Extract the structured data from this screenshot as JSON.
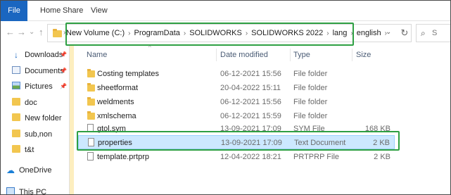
{
  "ribbon": {
    "tabs": [
      "File",
      "Home",
      "Share",
      "View"
    ]
  },
  "nav": {
    "back": "←",
    "forward": "→",
    "dropdown": "⌄",
    "up": "↑"
  },
  "address": {
    "crumbs": [
      "New Volume (C:)",
      "ProgramData",
      "SOLIDWORKS",
      "SOLIDWORKS 2022",
      "lang",
      "english"
    ],
    "separator": "›",
    "dropdown": "⌄",
    "refresh": "↻"
  },
  "search": {
    "placeholder": "S"
  },
  "sidebar": {
    "items": [
      {
        "label": "Downloads",
        "icon": "download-icon",
        "pinned": true
      },
      {
        "label": "Documents",
        "icon": "documents-icon",
        "pinned": true
      },
      {
        "label": "Pictures",
        "icon": "pictures-icon",
        "pinned": true
      },
      {
        "label": "doc",
        "icon": "folder-icon"
      },
      {
        "label": "New folder",
        "icon": "folder-icon"
      },
      {
        "label": "sub,non",
        "icon": "folder-icon"
      },
      {
        "label": "t&t",
        "icon": "folder-icon"
      },
      {
        "label": "OneDrive",
        "icon": "onedrive-icon"
      },
      {
        "label": "This PC",
        "icon": "pc-icon"
      }
    ],
    "pin_glyph": "📌"
  },
  "columns": {
    "name": "Name",
    "date": "Date modified",
    "type": "Type",
    "size": "Size",
    "sort_glyph": "^"
  },
  "files": [
    {
      "name": "Costing templates",
      "date": "06-12-2021 15:56",
      "type": "File folder",
      "size": "",
      "kind": "folder"
    },
    {
      "name": "sheetformat",
      "date": "20-04-2022 15:11",
      "type": "File folder",
      "size": "",
      "kind": "folder"
    },
    {
      "name": "weldments",
      "date": "06-12-2021 15:56",
      "type": "File folder",
      "size": "",
      "kind": "folder"
    },
    {
      "name": "xmlschema",
      "date": "06-12-2021 15:59",
      "type": "File folder",
      "size": "",
      "kind": "folder"
    },
    {
      "name": "gtol.sym",
      "date": "13-09-2021 17:09",
      "type": "SYM File",
      "size": "168 KB",
      "kind": "file"
    },
    {
      "name": "properties",
      "date": "13-09-2021 17:09",
      "type": "Text Document",
      "size": "2 KB",
      "kind": "file",
      "selected": true
    },
    {
      "name": "template.prtprp",
      "date": "12-04-2022 18:21",
      "type": "PRTPRP File",
      "size": "2 KB",
      "kind": "file"
    }
  ],
  "colors": {
    "file_tab": "#1a66c0",
    "selection": "#cce8ff",
    "highlight_box": "#2ea043",
    "folder": "#f2c64f"
  }
}
